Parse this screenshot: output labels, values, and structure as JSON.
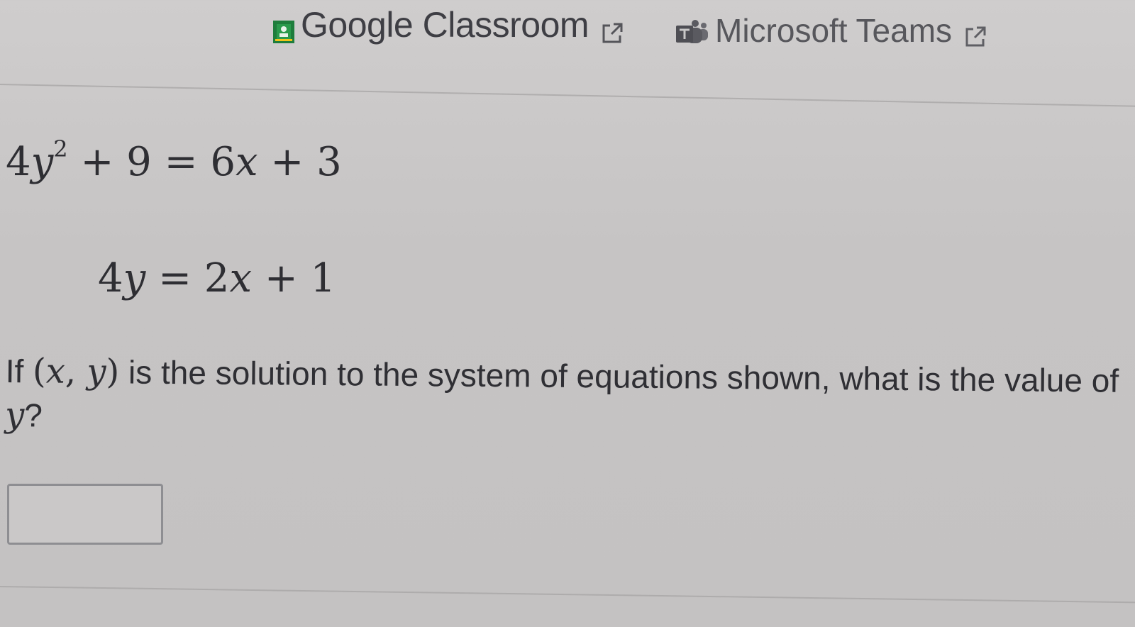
{
  "share": {
    "classroom_label": "Google Classroom",
    "teams_label": "Microsoft Teams"
  },
  "problem": {
    "eq1": {
      "coef": "4",
      "var": "y",
      "exp": "2",
      "rest_left": " + 9 = 6",
      "var2": "x",
      "rest_right": " + 3"
    },
    "eq2": {
      "coef": "4",
      "var": "y",
      "mid": " = 2",
      "var2": "x",
      "rest": " + 1"
    },
    "question": {
      "prefix": "If ",
      "open_paren": "(",
      "x": "x",
      "comma": ", ",
      "y": "y",
      "close_paren": ")",
      "middle": " is the solution to the system of equations shown, what is the value of ",
      "y_end": "y",
      "suffix": "?"
    },
    "answer": {
      "value": ""
    }
  },
  "colors": {
    "background": "#c6c4c4",
    "classroom_green": "#1e8e3e",
    "text": "#2f2f33"
  }
}
